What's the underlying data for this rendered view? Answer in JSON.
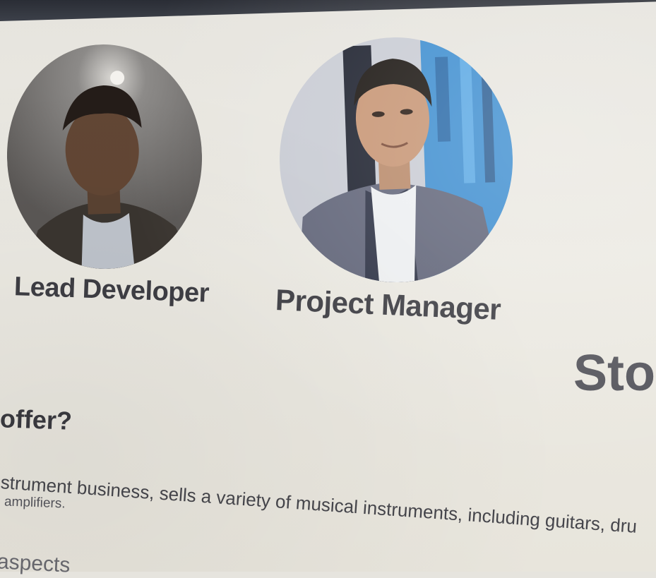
{
  "team": {
    "members": [
      {
        "role": "Lead Developer",
        "avatar_icon": "person-photo-icon"
      },
      {
        "role": "Project Manager",
        "avatar_icon": "person-photo-icon"
      }
    ]
  },
  "section": {
    "heading_partial": "Sto",
    "question_partial": "offer?",
    "paragraph_line1": "strument business, sells a variety of musical instruments, including guitars, dru",
    "paragraph_line2": "amplifiers.",
    "next_line_partial": "aspects"
  },
  "colors": {
    "page_bg": "#eceae3",
    "text": "#3e3e44",
    "heading": "#55555c",
    "bezel": "#2f323a"
  }
}
